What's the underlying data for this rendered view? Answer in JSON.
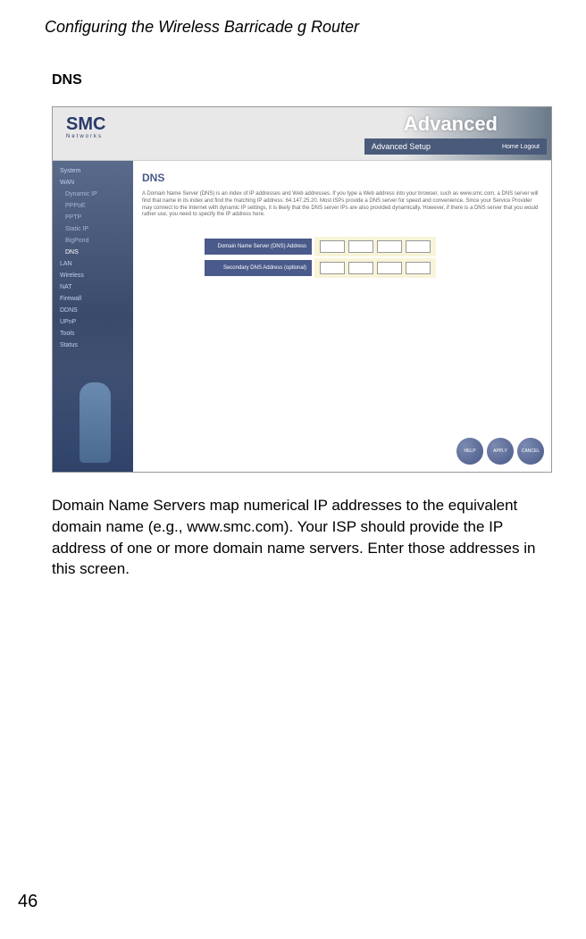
{
  "page": {
    "header": "Configuring the Wireless Barricade g Router",
    "section_title": "DNS",
    "body_text": "Domain Name Servers map numerical IP addresses to the equivalent domain name (e.g., www.smc.com). Your ISP should provide the IP address of one or more domain name servers. Enter those addresses in this screen.",
    "page_number": "46"
  },
  "screenshot": {
    "logo": "SMC",
    "logo_sub": "Networks",
    "header_brand": "Advanced",
    "header_sub": "Advanced Setup",
    "header_home": "Home  Logout",
    "sidebar": {
      "items": [
        {
          "label": "System",
          "type": "top"
        },
        {
          "label": "WAN",
          "type": "top"
        },
        {
          "label": "Dynamic IP",
          "type": "sub"
        },
        {
          "label": "PPPoE",
          "type": "sub"
        },
        {
          "label": "PPTP",
          "type": "sub"
        },
        {
          "label": "Static IP",
          "type": "sub"
        },
        {
          "label": "BigPond",
          "type": "sub"
        },
        {
          "label": "DNS",
          "type": "sub",
          "active": true
        },
        {
          "label": "LAN",
          "type": "top"
        },
        {
          "label": "Wireless",
          "type": "top"
        },
        {
          "label": "NAT",
          "type": "top"
        },
        {
          "label": "Firewall",
          "type": "top"
        },
        {
          "label": "DDNS",
          "type": "top"
        },
        {
          "label": "UPnP",
          "type": "top"
        },
        {
          "label": "Tools",
          "type": "top"
        },
        {
          "label": "Status",
          "type": "top"
        }
      ]
    },
    "content": {
      "title": "DNS",
      "desc": "A Domain Name Server (DNS) is an index of IP addresses and Web addresses. If you type a Web address into your browser, such as www.smc.com, a DNS server will find that name in its index and find the matching IP address: 64.147.25.20. Most ISPs provide a DNS server for speed and convenience. Since your Service Provider may connect to the Internet with dynamic IP settings, it is likely that the DNS server IPs are also provided dynamically. However, if there is a DNS server that you would rather use, you need to specify the IP address here.",
      "row1_label": "Domain Name Server (DNS) Address",
      "row2_label": "Secondary DNS Address (optional)"
    },
    "buttons": {
      "help": "HELP",
      "apply": "APPLY",
      "cancel": "CANCEL"
    }
  }
}
